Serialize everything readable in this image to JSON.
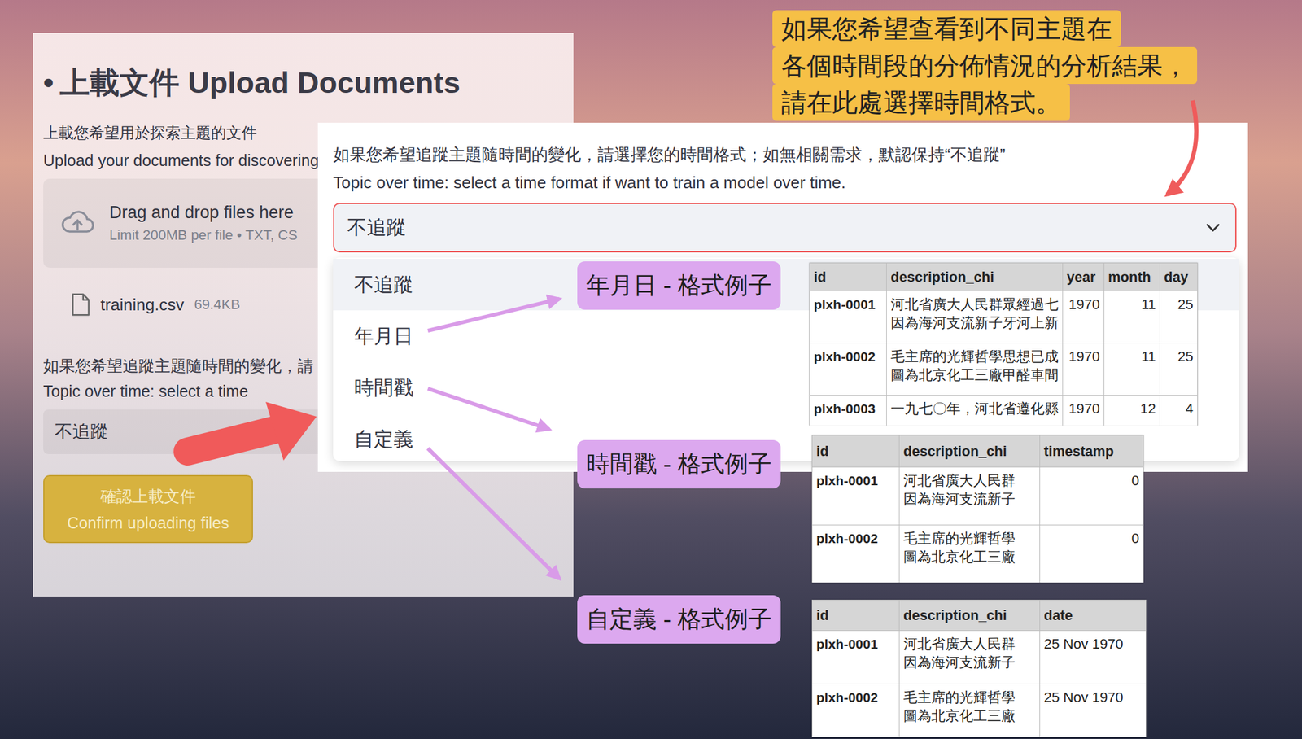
{
  "upload_panel": {
    "title_bullet": "•",
    "title": "上載文件 Upload Documents",
    "subtitle_chi": "上載您希望用於探索主題的文件",
    "subtitle_en": "Upload your documents for discovering t",
    "dropzone": {
      "text": "Drag and drop files here",
      "limit": "Limit 200MB per file • TXT, CS"
    },
    "file": {
      "name": "training.csv",
      "size": "69.4KB"
    },
    "time_label_chi": "如果您希望追蹤主題隨時間的變化，請",
    "time_label_en": "Topic over time: select a time",
    "select_value": "不追蹤",
    "confirm_button": {
      "chi": "確認上載文件",
      "en": "Confirm uploading files"
    }
  },
  "time_panel": {
    "label_chi": "如果您希望追蹤主題隨時間的變化，請選擇您的時間格式；如無相關需求，默認保持“不追蹤”",
    "label_en": "Topic over time: select a time format if want to train a model over time.",
    "select": {
      "value": "不追蹤",
      "expanded": true
    },
    "options": [
      {
        "label": "不追蹤",
        "selected": true
      },
      {
        "label": "年月日",
        "selected": false
      },
      {
        "label": "時間戳",
        "selected": false
      },
      {
        "label": "自定義",
        "selected": false
      }
    ]
  },
  "callout": {
    "lines": [
      "如果您希望查看到不同主題在",
      "各個時間段的分佈情況的分析結果，",
      "請在此處選擇時間格式。"
    ]
  },
  "examples": [
    {
      "label": "年月日 - 格式例子",
      "columns": [
        {
          "label": "id",
          "kind": "text"
        },
        {
          "label": "description_chi",
          "kind": "text"
        },
        {
          "label": "year",
          "kind": "number"
        },
        {
          "label": "month",
          "kind": "number"
        },
        {
          "label": "day",
          "kind": "number"
        }
      ],
      "rows": [
        {
          "cells": [
            [
              "plxh-0001"
            ],
            [
              "河北省廣大人民群眾經過七",
              "因為海河支流新子牙河上新"
            ],
            [
              "1970"
            ],
            [
              "11"
            ],
            [
              "25"
            ]
          ]
        },
        {
          "cells": [
            [
              "plxh-0002"
            ],
            [
              "毛主席的光輝哲學思想已成",
              "圖為北京化工三廠甲醛車間"
            ],
            [
              "1970"
            ],
            [
              "11"
            ],
            [
              "25"
            ]
          ]
        },
        {
          "cells": [
            [
              "plxh-0003"
            ],
            [
              "一九七〇年，河北省遵化縣"
            ],
            [
              "1970"
            ],
            [
              "12"
            ],
            [
              "4"
            ]
          ]
        }
      ]
    },
    {
      "label": "時間戳 - 格式例子",
      "columns": [
        {
          "label": "id",
          "kind": "text"
        },
        {
          "label": "description_chi",
          "kind": "text"
        },
        {
          "label": "timestamp",
          "kind": "number"
        }
      ],
      "rows": [
        {
          "cells": [
            [
              "plxh-0001"
            ],
            [
              "河北省廣大人民群",
              "因為海河支流新子"
            ],
            [
              "0"
            ]
          ]
        },
        {
          "cells": [
            [
              "plxh-0002"
            ],
            [
              "毛主席的光輝哲學",
              "圖為北京化工三廠"
            ],
            [
              "0"
            ]
          ]
        }
      ]
    },
    {
      "label": "自定義 - 格式例子",
      "columns": [
        {
          "label": "id",
          "kind": "text"
        },
        {
          "label": "description_chi",
          "kind": "text"
        },
        {
          "label": "date",
          "kind": "text"
        }
      ],
      "rows": [
        {
          "cells": [
            [
              "plxh-0001"
            ],
            [
              "河北省廣大人民群",
              "因為海河支流新子"
            ],
            [
              "25 Nov 1970"
            ]
          ]
        },
        {
          "cells": [
            [
              "plxh-0002"
            ],
            [
              "毛主席的光輝哲學",
              "圖為北京化工三廠"
            ],
            [
              "25 Nov 1970"
            ]
          ]
        }
      ]
    }
  ]
}
